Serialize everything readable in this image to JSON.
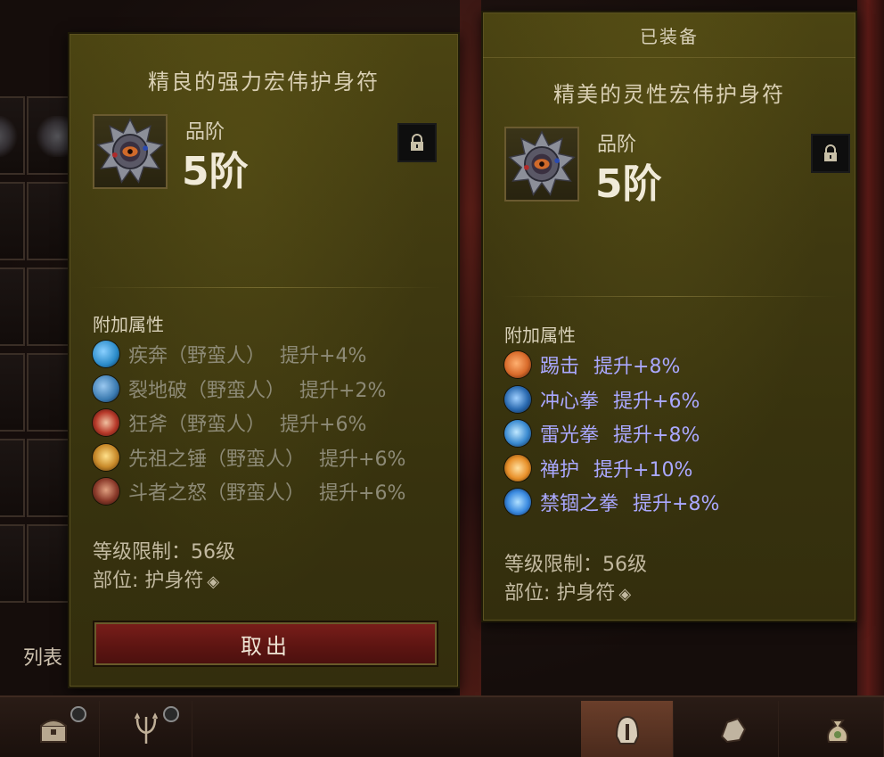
{
  "left_panel": {
    "title": "精良的强力宏伟护身符",
    "tier_label": "品阶",
    "tier_value": "5阶",
    "affix_header": "附加属性",
    "affixes": [
      {
        "name": "疾奔（野蛮人）",
        "bonus": "提升+4%",
        "icon": "sprint-skill-icon",
        "color": "#2a8ac8"
      },
      {
        "name": "裂地破（野蛮人）",
        "bonus": "提升+2%",
        "icon": "earthquake-skill-icon",
        "color": "#3a7ab0"
      },
      {
        "name": "狂斧（野蛮人）",
        "bonus": "提升+6%",
        "icon": "frenzy-skill-icon",
        "color": "#b83a2a"
      },
      {
        "name": "先祖之锤（野蛮人）",
        "bonus": "提升+6%",
        "icon": "hammer-skill-icon",
        "color": "#c88a2a"
      },
      {
        "name": "斗者之怒（野蛮人）",
        "bonus": "提升+6%",
        "icon": "wrath-skill-icon",
        "color": "#8a3a2a"
      }
    ],
    "level_req": "等级限制：56级",
    "slot": "部位: 护身符",
    "take_out_button": "取出"
  },
  "right_panel": {
    "header": "已装备",
    "title": "精美的灵性宏伟护身符",
    "tier_label": "品阶",
    "tier_value": "5阶",
    "affix_header": "附加属性",
    "affixes": [
      {
        "name": "踢击",
        "bonus": "提升+8%",
        "icon": "kick-skill-icon",
        "color": "#d86a2a"
      },
      {
        "name": "冲心拳",
        "bonus": "提升+6%",
        "icon": "heart-punch-skill-icon",
        "color": "#2a6ab0"
      },
      {
        "name": "雷光拳",
        "bonus": "提升+8%",
        "icon": "thunder-fist-skill-icon",
        "color": "#3a8ad0"
      },
      {
        "name": "禅护",
        "bonus": "提升+10%",
        "icon": "zen-guard-skill-icon",
        "color": "#e8902a"
      },
      {
        "name": "禁锢之拳",
        "bonus": "提升+8%",
        "icon": "binding-fist-skill-icon",
        "color": "#3a8ae0"
      }
    ],
    "level_req": "等级限制：56级",
    "slot": "部位: 护身符"
  },
  "background": {
    "list_label": "列表"
  },
  "bottom_tabs": [
    {
      "icon": "treasure-chest-icon",
      "active": false
    },
    {
      "icon": "trident-icon",
      "active": false
    },
    {
      "icon": "helmet-icon",
      "active": true
    },
    {
      "icon": "ore-icon",
      "active": false
    },
    {
      "icon": "money-bag-icon",
      "active": false
    }
  ]
}
